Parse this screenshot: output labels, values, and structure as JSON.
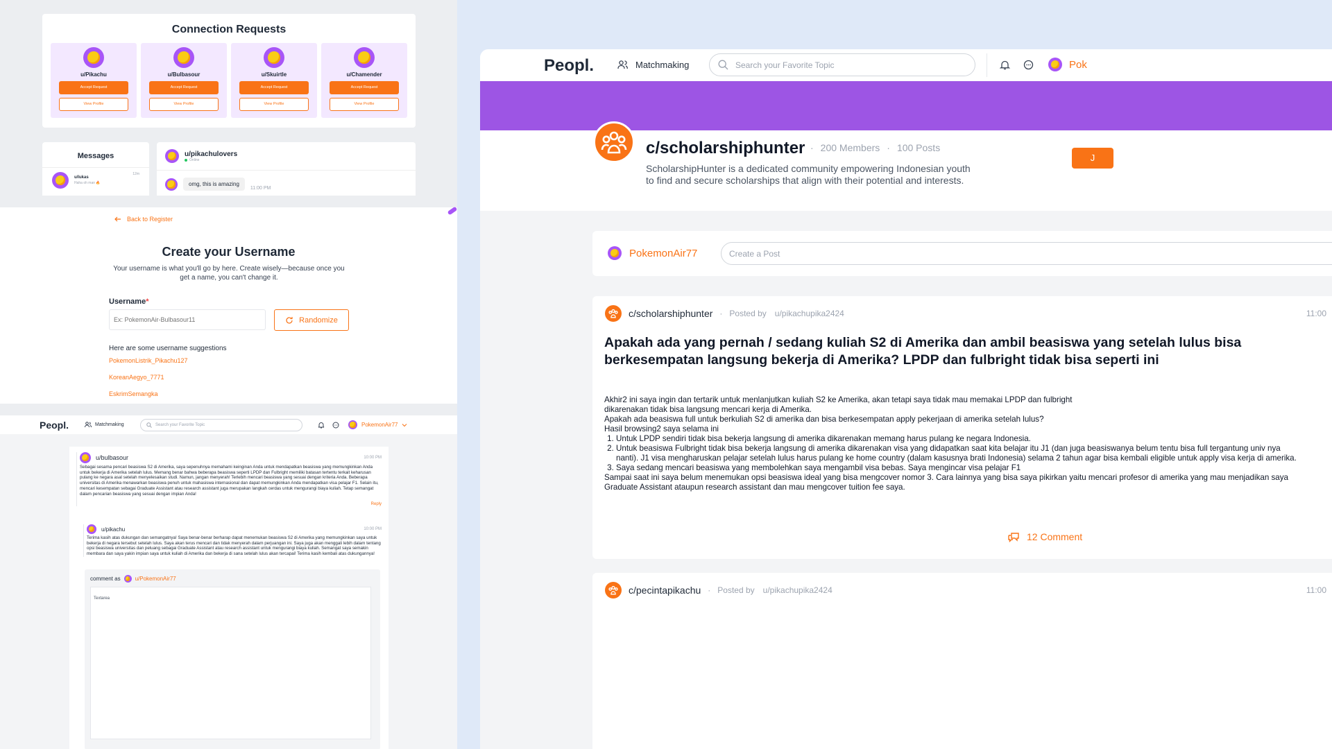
{
  "colors": {
    "accent": "#f97316",
    "banner": "#9d55e4",
    "lavender": "#f3e8ff",
    "blue_bg": "#dbeafe"
  },
  "connections": {
    "title": "Connection Requests",
    "items": [
      {
        "user": "u/Pikachu",
        "accept": "Accept Request",
        "view": "View Profile"
      },
      {
        "user": "u/Bulbasour",
        "accept": "Accept Request",
        "view": "View Profile"
      },
      {
        "user": "u/Skuirtle",
        "accept": "Accept Request",
        "view": "View Profile"
      },
      {
        "user": "u/Chamender",
        "accept": "Accept Request",
        "view": "View Profile"
      }
    ]
  },
  "messages": {
    "title": "Messages",
    "item": {
      "user": "u/lukas",
      "preview": "Haha oh man 🔥",
      "time": "12m"
    },
    "chat": {
      "user": "u/pikachulovers",
      "status": "Online",
      "bubble": "omg, this is amazing",
      "time": "11:00 PM"
    }
  },
  "register": {
    "back": "Back to Register",
    "title": "Create your Username",
    "desc": "Your username is what you'll go by here. Create wisely—because once you get a name, you can't change it.",
    "label": "Username",
    "required": "*",
    "placeholder": "Ex: PokemonAir-Bulbasour11",
    "randomize": "Randomize",
    "suggest_title": "Here are some username suggestions",
    "suggestions": [
      "PokemonListrik_Pikachu127",
      "KoreanAegyo_7771",
      "EskrimSemangka"
    ]
  },
  "thread_nav": {
    "logo": "Peopl.",
    "matchmaking": "Matchmaking",
    "search_placeholder": "Search your Favorite Topic",
    "user": "PokemonAir77"
  },
  "thread": {
    "c1": {
      "user": "u/bulbasour",
      "time": "10:00 PM",
      "text": "Sebagai sesama pencari beasiswa S2 di Amerika, saya sepenuhnya memahami keinginan Anda untuk mendapatkan beasiswa yang memungkinkan Anda untuk bekerja di Amerika setelah lulus. Memang benar bahwa beberapa beasiswa seperti LPDP dan Fulbright memiliki batasan tertentu terkait keharusan pulang ke negara asal setelah menyelesaikan studi. Namun, jangan menyerah! Terlebih mencari beasiswa yang sesuai dengan kriteria Anda. Beberapa universitas di Amerika menawarkan beasiswa penuh untuk mahasiswa internasional dan dapat memungkinkan Anda mendapatkan visa pelajar F1. Selain itu, mencari kesempatan sebagai Graduate Assistant atau research assistant juga merupakan langkah cerdas untuk mengurangi biaya kuliah. Tetap semangat dalam pencarian beasiswa yang sesuai dengan impian Anda!",
      "reply": "Reply"
    },
    "c2": {
      "user": "u/pikachu",
      "time": "10:00 PM",
      "text": "Terima kasih atas dukungan dan semangatnya! Saya benar-benar berharap dapat menemukan beasiswa S2 di Amerika yang memungkinkan saya untuk bekerja di negara tersebut setelah lulus. Saya akan terus mencari dan tidak menyerah dalam perjuangan ini. Saya juga akan menggali lebih dalam tentang opsi beasiswa universitas dan peluang sebagai Graduate Assistant atau research assistant untuk mengurangi biaya kuliah. Semangat saya semakin membara dan saya yakin impian saya untuk kuliah di Amerika dan bekerja di sana setelah lulus akan tercapai! Terima kasih kembali atas dukungannya!"
    },
    "comment_as": "comment as",
    "comment_user": "u/PokemonAir77",
    "textarea": "Textarea"
  },
  "main_nav": {
    "logo": "Peopl.",
    "matchmaking": "Matchmaking",
    "search_placeholder": "Search your Favorite Topic",
    "user": "Pok"
  },
  "community": {
    "name": "c/scholarshiphunter",
    "members": "200 Members",
    "posts": "100 Posts",
    "desc_line1": "ScholarshipHunter is a dedicated community empowering Indonesian youth",
    "desc_line2": "to find and secure scholarships that align with their potential and interests.",
    "join": "J"
  },
  "composer": {
    "user": "PokemonAir77",
    "placeholder": "Create a Post"
  },
  "post1": {
    "community": "c/scholarshiphunter",
    "posted_by": "Posted by",
    "author": "u/pikachupika2424",
    "time": "11:00",
    "title": "Apakah ada yang pernah / sedang kuliah S2 di Amerika dan ambil beasiswa yang setelah lulus bisa berkesempatan langsung bekerja di Amerika? LPDP dan fulbright tidak bisa seperti ini",
    "body1": "Akhir2 ini saya ingin dan tertarik untuk menlanjutkan kuliah S2 ke Amerika, akan tetapi saya tidak mau memakai LPDP dan fulbright",
    "body2": "dikarenakan tidak bisa langsung mencari kerja di Amerika.",
    "body3": "Apakah ada beasiswa full untuk berkuliah S2 di amerika dan bisa berkesempatan apply pekerjaan di amerika setelah lulus?",
    "body4": "Hasil browsing2 saya selama ini",
    "list": [
      "Untuk LPDP sendiri tidak bisa bekerja langsung di amerika dikarenakan memang harus pulang ke negara Indonesia.",
      "Untuk beasiswa Fulbright tidak bisa bekerja langsung di amerika dikarenakan visa yang didapatkan saat kita belajar itu J1 (dan juga beasiswanya belum tentu bisa full tergantung univ nya nanti). J1 visa mengharuskan pelajar setelah lulus harus pulang ke home country (dalam kasusnya brati Indonesia) selama 2 tahun agar bisa kembali eligible untuk apply visa kerja di amerika.",
      "Saya sedang mencari beasiswa yang membolehkan saya mengambil visa bebas. Saya mengincar visa pelajar F1"
    ],
    "body5": "Sampai saat ini saya belum menemukan opsi beasiswa ideal yang bisa mengcover nomor 3. Cara lainnya yang bisa saya pikirkan yaitu mencari profesor di amerika yang mau menjadikan saya Graduate Assistant ataupun research assistant dan mau mengcover tuition fee saya.",
    "comments": "12 Comment"
  },
  "post2": {
    "community": "c/pecintapikachu",
    "posted_by": "Posted by",
    "author": "u/pikachupika2424",
    "time": "11:00"
  }
}
